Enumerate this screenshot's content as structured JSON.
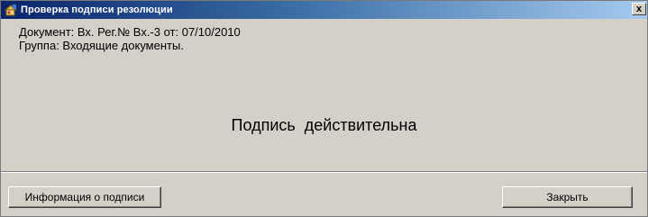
{
  "window": {
    "title": "Проверка подписи резолюции",
    "close_glyph": "x"
  },
  "document": {
    "line1": "Документ: Вх. Рег.№ Вх.-3 от: 07/10/2010",
    "line2": "Группа: Входящие документы."
  },
  "status": "Подпись  действительна",
  "buttons": {
    "info_label": "Информация о подписи",
    "close_label": "Закрыть"
  },
  "icons": {
    "title": "app-icon",
    "close": "close-icon"
  }
}
